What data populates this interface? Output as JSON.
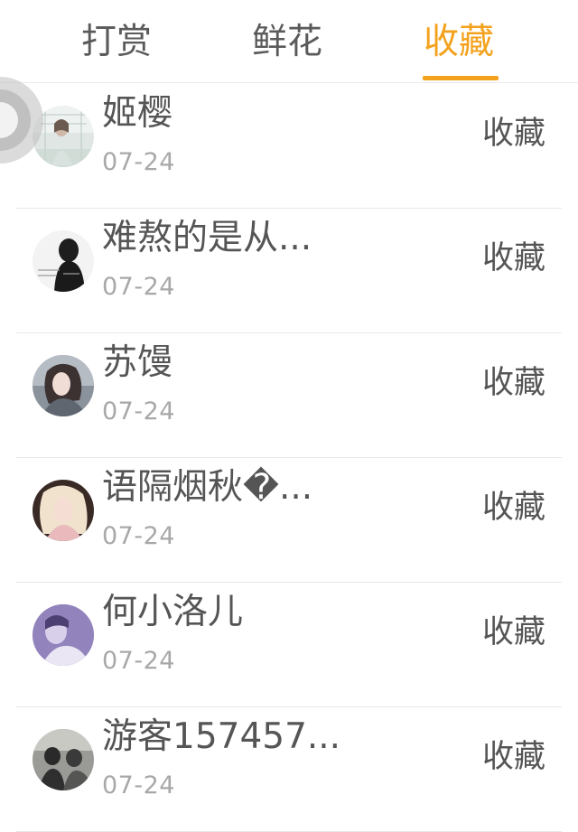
{
  "tabs": [
    {
      "label": "打赏"
    },
    {
      "label": "鲜花"
    },
    {
      "label": "收藏",
      "active": true
    }
  ],
  "colors": {
    "accent": "#f4a21d",
    "text": "#555555",
    "muted": "#a8a8a8",
    "divider": "#e8e8e8"
  },
  "list": [
    {
      "name": "姬樱",
      "date": "07-24",
      "action": "收藏",
      "avatar": "avatar-user-1"
    },
    {
      "name": "难熬的是从...",
      "date": "07-24",
      "action": "收藏",
      "avatar": "avatar-user-2"
    },
    {
      "name": "苏馒",
      "date": "07-24",
      "action": "收藏",
      "avatar": "avatar-user-3"
    },
    {
      "name": "语隔烟秋�...",
      "date": "07-24",
      "action": "收藏",
      "avatar": "avatar-user-4"
    },
    {
      "name": "何小洛儿",
      "date": "07-24",
      "action": "收藏",
      "avatar": "avatar-user-5"
    },
    {
      "name": "游客157457...",
      "date": "07-24",
      "action": "收藏",
      "avatar": "avatar-user-6"
    }
  ],
  "floating_button": {
    "icon": "assistive-touch-icon"
  }
}
